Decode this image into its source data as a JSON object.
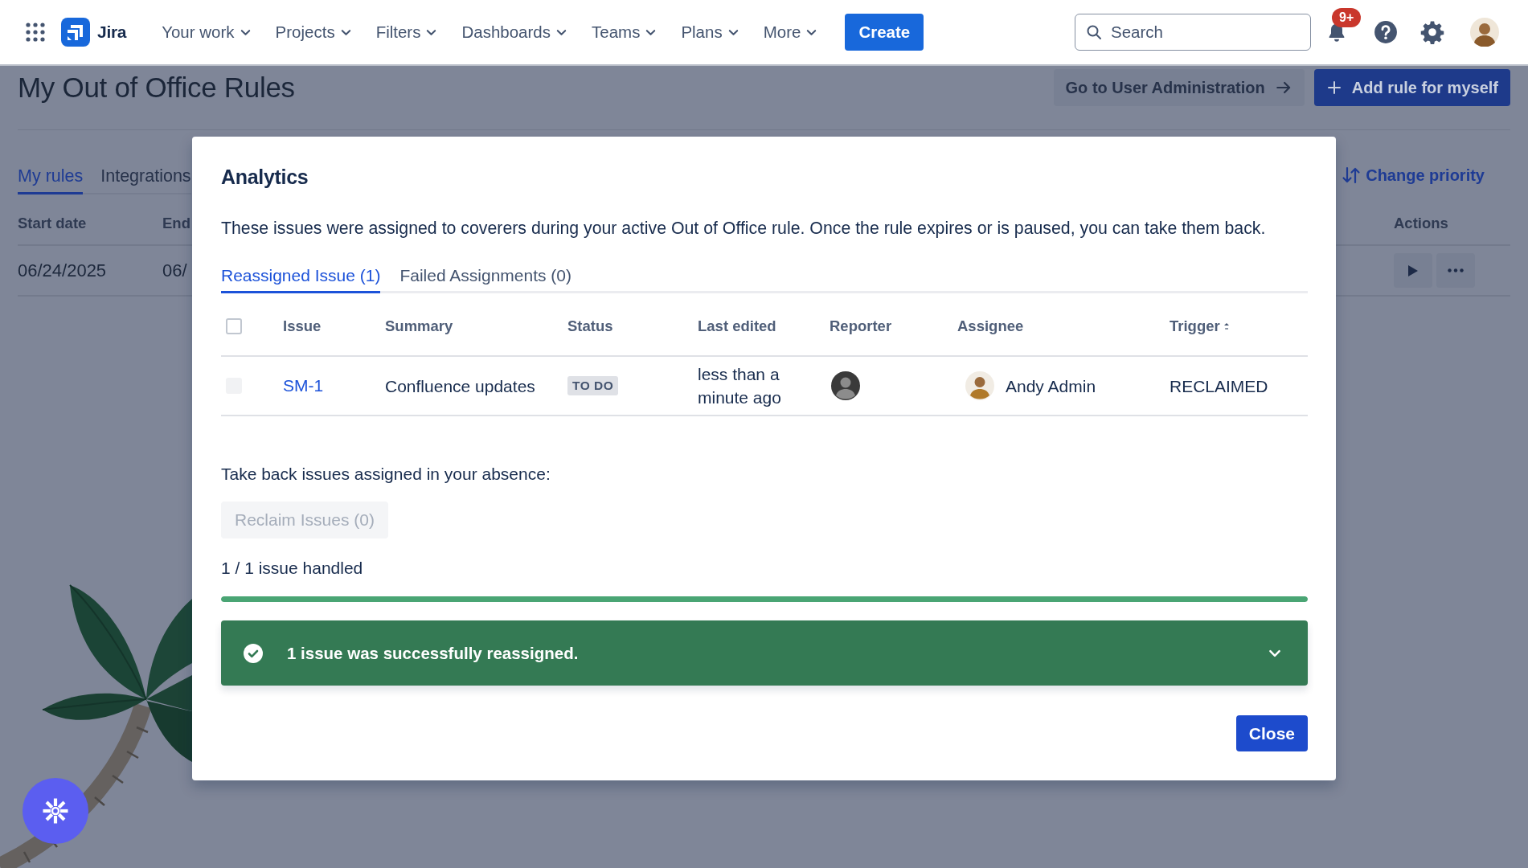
{
  "top_nav": {
    "product": "Jira",
    "menus": [
      "Your work",
      "Projects",
      "Filters",
      "Dashboards",
      "Teams",
      "Plans",
      "More"
    ],
    "create": "Create",
    "search": {
      "placeholder": "Search"
    },
    "notification_badge": "9+"
  },
  "page": {
    "title": "My Out of Office Rules",
    "actions": [
      {
        "label": "Go to User Administration",
        "kind": "secondary"
      },
      {
        "label": "Add rule for myself",
        "kind": "primary"
      }
    ],
    "tabs": [
      {
        "label": "My rules",
        "selected": true
      },
      {
        "label": "Integrations",
        "selected": false
      }
    ],
    "change_priority": "Change priority",
    "table": {
      "columns": [
        "Start date",
        "End",
        "Actions"
      ],
      "rows": [
        {
          "start_date": "06/24/2025",
          "end_date": "06/"
        }
      ]
    }
  },
  "modal": {
    "title": "Analytics",
    "description": "These issues were assigned to coverers during your active Out of Office rule. Once the rule expires or is paused, you can take them back.",
    "tabs": [
      {
        "label": "Reassigned Issue (1)",
        "selected": true
      },
      {
        "label": "Failed Assignments (0)",
        "selected": false
      }
    ],
    "table": {
      "select_all": {
        "checked": false,
        "disabled": false
      },
      "columns": [
        {
          "label": "Issue",
          "sorted": false
        },
        {
          "label": "Summary",
          "sorted": false
        },
        {
          "label": "Status",
          "sorted": false
        },
        {
          "label": "Last edited",
          "sorted": false
        },
        {
          "label": "Reporter",
          "sorted": false
        },
        {
          "label": "Assignee",
          "sorted": false
        },
        {
          "label": "Trigger",
          "sorted": true
        }
      ],
      "rows": [
        {
          "checked": false,
          "disabled": true,
          "issue": "SM-1",
          "summary": "Confluence updates",
          "status": "TO DO",
          "last_edited": "less than a minute ago",
          "assignee": "Andy Admin",
          "trigger": "RECLAIMED"
        }
      ]
    },
    "reclaim": {
      "prompt": "Take back issues assigned in your absence:",
      "button": {
        "label": "Reclaim Issues (0)",
        "disabled": true
      }
    },
    "progress": {
      "label": "1 / 1 issue handled",
      "level": 1
    },
    "banner": {
      "message": "1 issue was successfully reassigned.",
      "expanded": false
    },
    "close": "Close"
  }
}
